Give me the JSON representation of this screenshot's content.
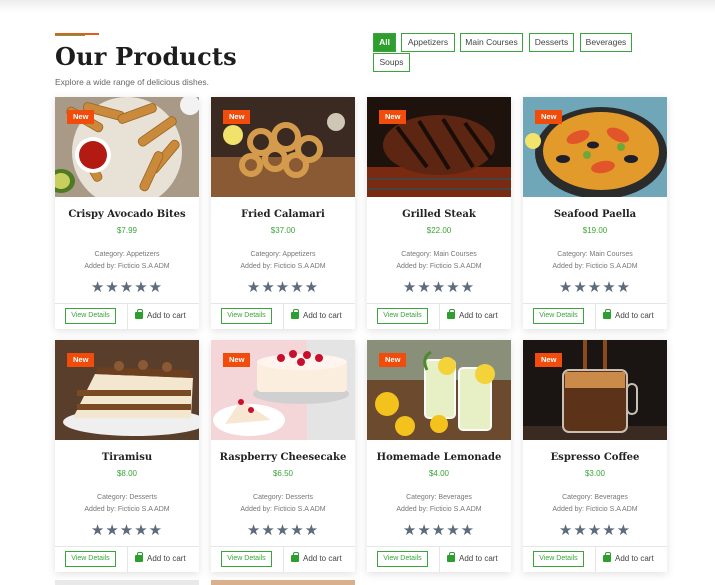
{
  "header": {
    "title": "Our Products",
    "subtitle": "Explore a wide range of delicious dishes."
  },
  "filters": [
    "All",
    "Appetizers",
    "Main Courses",
    "Desserts",
    "Beverages",
    "Soups"
  ],
  "active_filter": "All",
  "labels": {
    "badge": "New",
    "view_details": "View Details",
    "add_to_cart": "Add to cart",
    "stars": "★★★★★"
  },
  "colors": {
    "accent_green": "#2e9e2e",
    "badge_orange": "#f24c0c",
    "price_green": "#3aa53a",
    "star_gray": "#5d6b7c"
  },
  "products": [
    {
      "name": "Crispy Avocado Bites",
      "price": "$7.99",
      "category": "Category: Appetizers",
      "added_by": "Added by: Ficticio S.A ADM",
      "rating": 0
    },
    {
      "name": "Fried Calamari",
      "price": "$37.00",
      "category": "Category: Appetizers",
      "added_by": "Added by: Ficticio S.A ADM",
      "rating": 0
    },
    {
      "name": "Grilled Steak",
      "price": "$22.00",
      "category": "Category: Main Courses",
      "added_by": "Added by: Ficticio S.A ADM",
      "rating": 0
    },
    {
      "name": "Seafood Paella",
      "price": "$19.00",
      "category": "Category: Main Courses",
      "added_by": "Added by: Ficticio S.A ADM",
      "rating": 0
    },
    {
      "name": "Tiramisu",
      "price": "$8.00",
      "category": "Category: Desserts",
      "added_by": "Added by: Ficticio S.A ADM",
      "rating": 0
    },
    {
      "name": "Raspberry Cheesecake",
      "price": "$6.50",
      "category": "Category: Desserts",
      "added_by": "Added by: Ficticio S.A ADM",
      "rating": 0
    },
    {
      "name": "Homemade Lemonade",
      "price": "$4.00",
      "category": "Category: Beverages",
      "added_by": "Added by: Ficticio S.A ADM",
      "rating": 0
    },
    {
      "name": "Espresso Coffee",
      "price": "$3.00",
      "category": "Category: Beverages",
      "added_by": "Added by: Ficticio S.A ADM",
      "rating": 0
    }
  ]
}
